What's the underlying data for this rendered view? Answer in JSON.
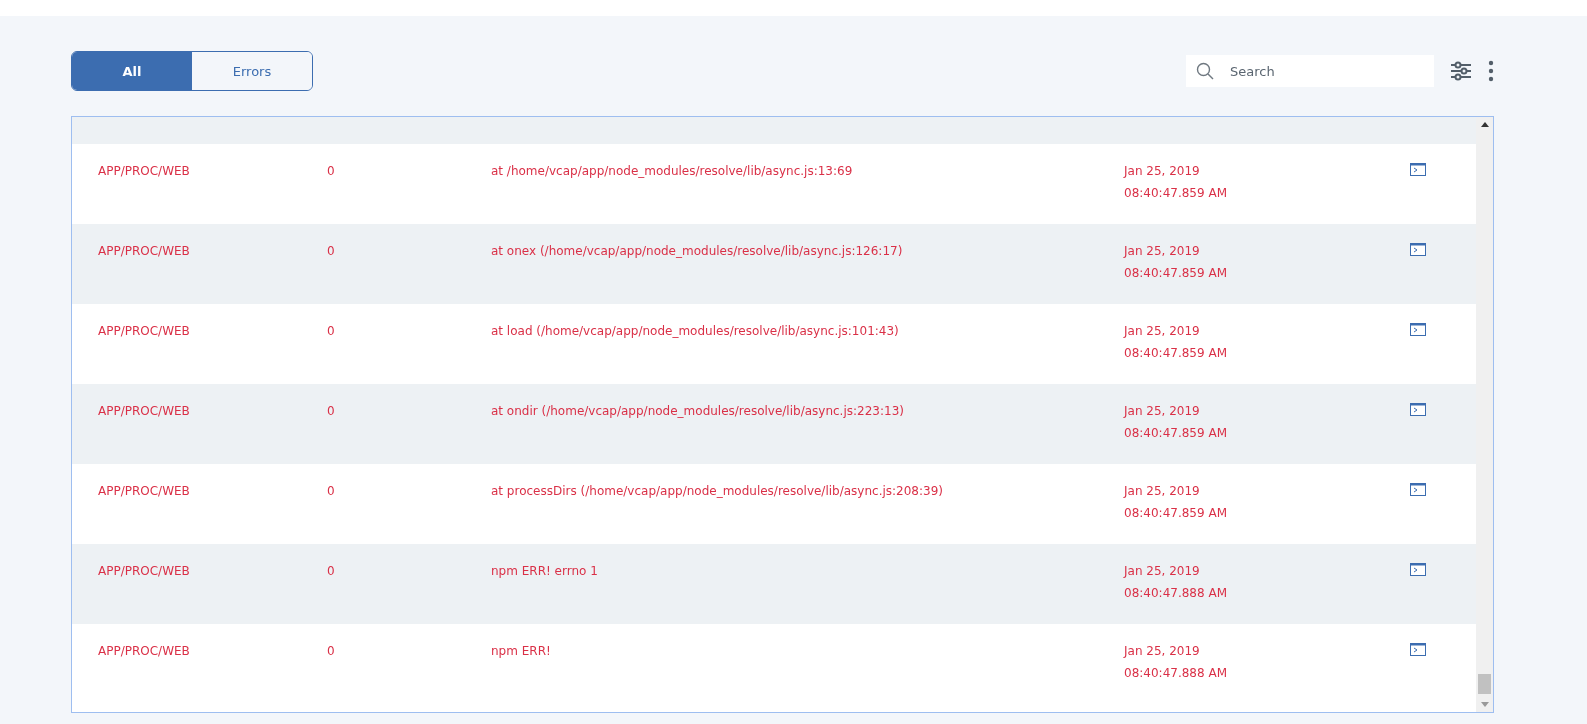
{
  "filter_tabs": [
    {
      "label": "All",
      "selected": true
    },
    {
      "label": "Errors",
      "selected": false
    }
  ],
  "search": {
    "placeholder": "Search"
  },
  "rows": [
    {
      "source": "APP/PROC/WEB",
      "instance": "0",
      "message": "at /home/vcap/app/node_modules/resolve/lib/async.js:13:69",
      "date": "Jan 25, 2019",
      "time": "08:40:47.859 AM"
    },
    {
      "source": "APP/PROC/WEB",
      "instance": "0",
      "message": "at onex (/home/vcap/app/node_modules/resolve/lib/async.js:126:17)",
      "date": "Jan 25, 2019",
      "time": "08:40:47.859 AM"
    },
    {
      "source": "APP/PROC/WEB",
      "instance": "0",
      "message": "at load (/home/vcap/app/node_modules/resolve/lib/async.js:101:43)",
      "date": "Jan 25, 2019",
      "time": "08:40:47.859 AM"
    },
    {
      "source": "APP/PROC/WEB",
      "instance": "0",
      "message": "at ondir (/home/vcap/app/node_modules/resolve/lib/async.js:223:13)",
      "date": "Jan 25, 2019",
      "time": "08:40:47.859 AM"
    },
    {
      "source": "APP/PROC/WEB",
      "instance": "0",
      "message": "at processDirs (/home/vcap/app/node_modules/resolve/lib/async.js:208:39)",
      "date": "Jan 25, 2019",
      "time": "08:40:47.859 AM"
    },
    {
      "source": "APP/PROC/WEB",
      "instance": "0",
      "message": "npm ERR! errno 1",
      "date": "Jan 25, 2019",
      "time": "08:40:47.888 AM"
    },
    {
      "source": "APP/PROC/WEB",
      "instance": "0",
      "message": "npm ERR!",
      "date": "Jan 25, 2019",
      "time": "08:40:47.888 AM"
    }
  ]
}
